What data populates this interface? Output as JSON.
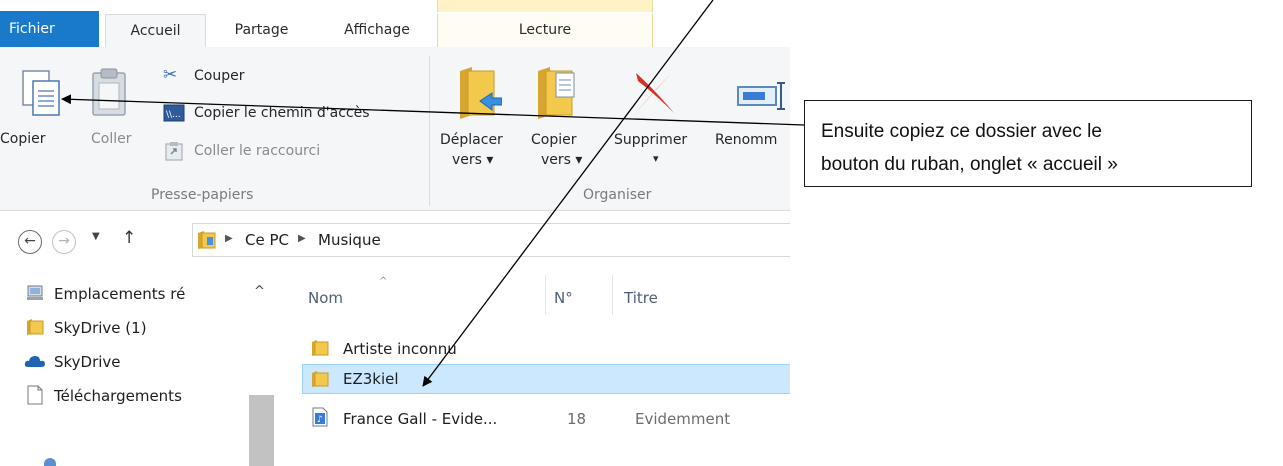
{
  "tabs": {
    "file": "Fichier",
    "home": "Accueil",
    "share": "Partage",
    "view": "Affichage",
    "play": "Lecture"
  },
  "ribbon": {
    "copy": "Copier",
    "paste": "Coller",
    "cut": "Couper",
    "copy_path": "Copier le chemin d'accès",
    "paste_shortcut": "Coller le raccourci",
    "group_clipboard": "Presse-papiers",
    "move_to_1": "Déplacer",
    "move_to_2": "vers",
    "copy_to_1": "Copier",
    "copy_to_2": "vers",
    "delete": "Supprimer",
    "rename": "Renomm",
    "group_organize": "Organiser"
  },
  "address": {
    "crumbs": [
      "Ce PC",
      "Musique"
    ]
  },
  "nav": {
    "items": [
      {
        "label": "Emplacements ré",
        "icon": "network-places-icon"
      },
      {
        "label": "SkyDrive (1)",
        "icon": "folder-icon"
      },
      {
        "label": "SkyDrive",
        "icon": "skydrive-cloud-icon"
      },
      {
        "label": "Téléchargements",
        "icon": "document-icon"
      }
    ]
  },
  "columns": {
    "name": "Nom",
    "number": "N°",
    "title": "Titre"
  },
  "files": [
    {
      "name": "Artiste inconnu",
      "number": "",
      "title": "",
      "icon": "folder-icon"
    },
    {
      "name": "EZ3kiel",
      "number": "",
      "title": "",
      "icon": "folder-icon",
      "selected": true
    },
    {
      "name": "France Gall - Evide...",
      "number": "18",
      "title": "Evidemment",
      "icon": "audio-file-icon"
    }
  ],
  "callout": {
    "line1": "Ensuite copiez ce dossier avec le",
    "line2": "bouton du ruban, onglet « accueil »"
  },
  "colors": {
    "file_tab": "#1979ca",
    "selection": "#cce8ff",
    "folder": "#e8b93a"
  }
}
